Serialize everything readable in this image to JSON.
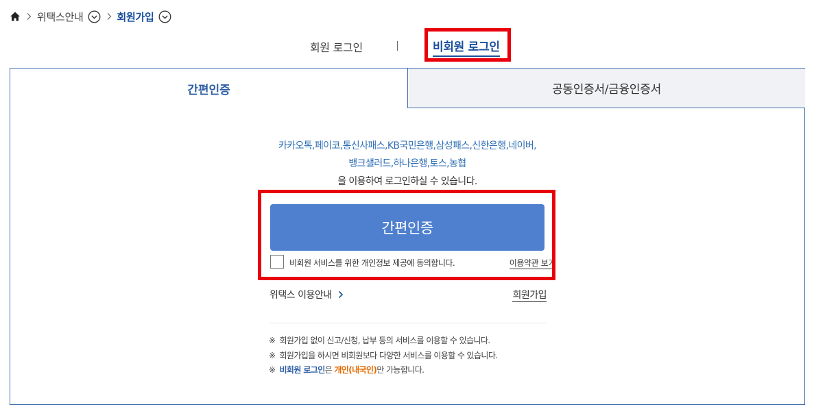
{
  "breadcrumb": {
    "items": [
      "위택스안내",
      "회원가입"
    ]
  },
  "login_type": {
    "member": "회원 로그인",
    "nonmember": "비회원 로그인"
  },
  "tabs": {
    "simple": "간편인증",
    "cert": "공동인증서/금융인증서"
  },
  "providers": {
    "line1": "카카오톡,페이코,통신사패스,KB국민은행,삼성패스,신한은행,네이버,",
    "line2": "뱅크샐러드,하나은행,토스,농협",
    "line3": "을 이용하여 로그인하실 수 있습니다."
  },
  "simple_button": "간편인증",
  "agreement": {
    "text": "비회원 서비스를 위한 개인정보 제공에 동의합니다.",
    "terms_link": "이용약관 보기",
    "checked": false
  },
  "links": {
    "guide": "위택스 이용안내",
    "signup": "회원가입"
  },
  "notes": {
    "mark": "※",
    "note1": "회원가입 없이 신고/신청, 납부 등의 서비스를 이용할 수 있습니다.",
    "note2": "회원가입을 하시면 비회원보다 다양한 서비스를 이용할 수 있습니다.",
    "note3_a": "비회원 로그인",
    "note3_b": "은 ",
    "note3_c": "개인(내국인)",
    "note3_d": "만 가능합니다."
  },
  "colors": {
    "accent": "#1a4f9c",
    "button": "#4f80cf",
    "highlight": "#e8000b",
    "orange": "#e56a00"
  },
  "icons": [
    "home-icon",
    "chevron-right-icon",
    "circle-chevron-down-icon",
    "chevron-right-small-icon"
  ]
}
